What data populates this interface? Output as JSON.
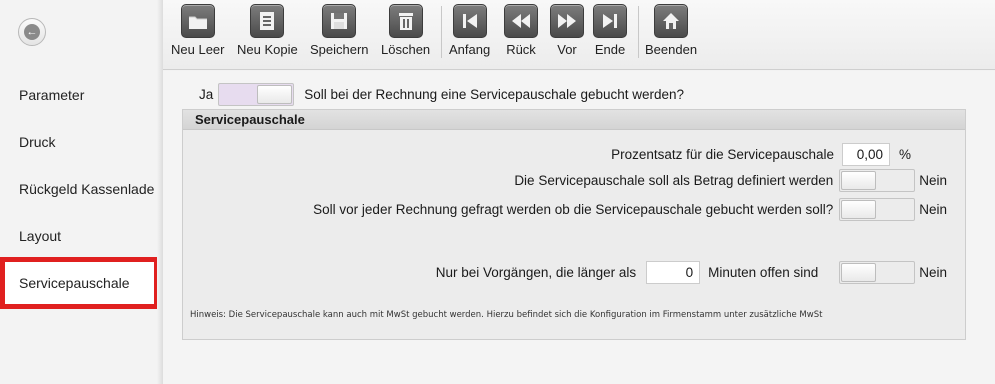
{
  "sidebar": {
    "items": [
      {
        "label": "Parameter"
      },
      {
        "label": "Druck"
      },
      {
        "label": "Rückgeld Kassenlade"
      },
      {
        "label": "Layout"
      },
      {
        "label": "Servicepauschale"
      }
    ],
    "active_index": 4
  },
  "toolbar": {
    "buttons": [
      {
        "label": "Neu Leer",
        "icon": "folder-new-icon"
      },
      {
        "label": "Neu Kopie",
        "icon": "copy-document-icon"
      },
      {
        "label": "Speichern",
        "icon": "save-disk-icon"
      },
      {
        "label": "Löschen",
        "icon": "trash-icon"
      },
      {
        "label": "Anfang",
        "icon": "first-record-icon"
      },
      {
        "label": "Rück",
        "icon": "previous-record-icon"
      },
      {
        "label": "Vor",
        "icon": "next-record-icon"
      },
      {
        "label": "Ende",
        "icon": "last-record-icon"
      },
      {
        "label": "Beenden",
        "icon": "home-icon"
      }
    ]
  },
  "main": {
    "ja_label": "Ja",
    "question": "Soll bei der Rechnung eine Servicepauschale gebucht werden?",
    "panel_title": "Servicepauschale",
    "percent_label": "Prozentsatz für die Servicepauschale",
    "percent_value": "0,00",
    "percent_unit": "%",
    "betrag_label": "Die Servicepauschale soll als Betrag definiert werden",
    "betrag_state": "Nein",
    "ask_label": "Soll vor jeder Rechnung gefragt werden ob die Servicepauschale gebucht werden soll?",
    "ask_state": "Nein",
    "minutes_prefix": "Nur bei Vorgängen, die länger als",
    "minutes_value": "0",
    "minutes_suffix": "Minuten offen sind",
    "minutes_state": "Nein",
    "hint": "Hinweis: Die Servicepauschale kann auch mit MwSt gebucht werden. Hierzu befindet sich die Konfiguration im Firmenstamm unter zusätzliche MwSt"
  },
  "colors": {
    "active_outline": "#e0201f",
    "toggle_on": "#e7dcef"
  }
}
